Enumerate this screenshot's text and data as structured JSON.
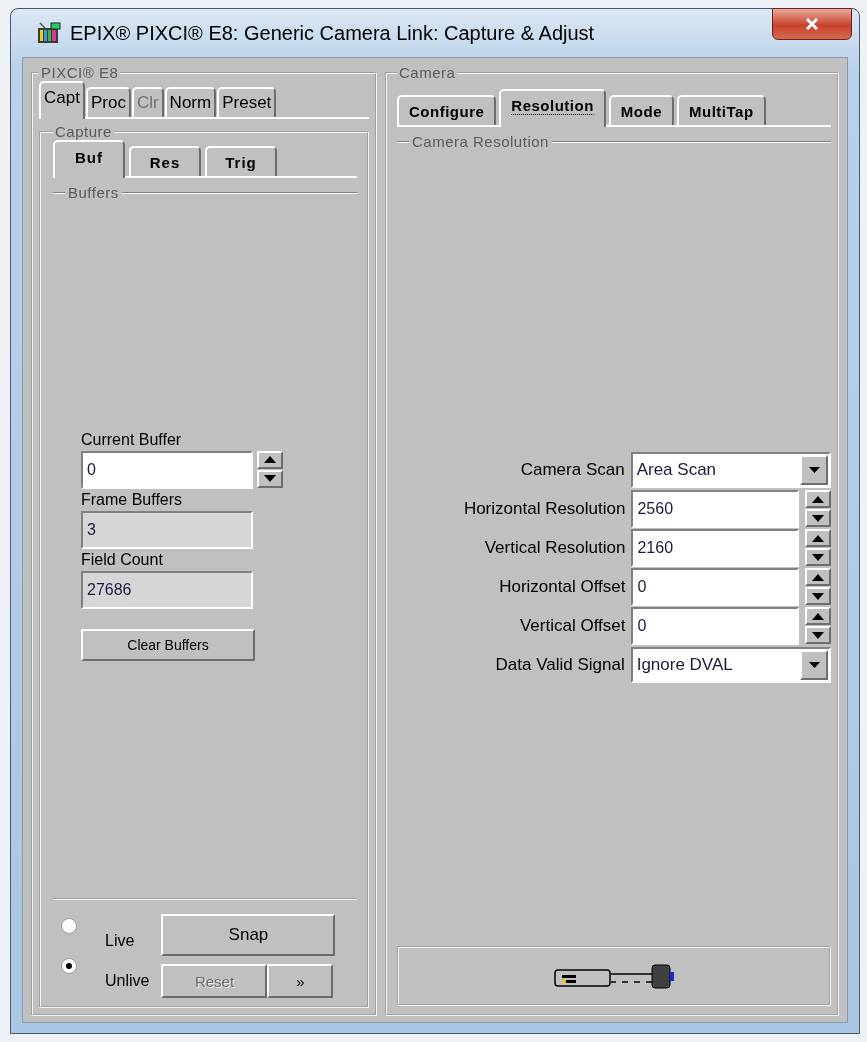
{
  "window": {
    "title": "EPIX® PIXCI® E8: Generic Camera Link: Capture & Adjust"
  },
  "left_panel": {
    "title": "PIXCI® E8",
    "tabs": [
      {
        "label": "Capt",
        "selected": true,
        "disabled": false
      },
      {
        "label": "Proc",
        "selected": false,
        "disabled": false
      },
      {
        "label": "Clr",
        "selected": false,
        "disabled": true
      },
      {
        "label": "Norm",
        "selected": false,
        "disabled": false
      },
      {
        "label": "Preset",
        "selected": false,
        "disabled": false
      }
    ],
    "capture": {
      "title": "Capture",
      "tabs": [
        {
          "label": "Buf",
          "selected": true
        },
        {
          "label": "Res",
          "selected": false
        },
        {
          "label": "Trig",
          "selected": false
        }
      ],
      "section_title": "Buffers",
      "fields": [
        {
          "label": "Current Buffer",
          "value": "0",
          "kind": "spin"
        },
        {
          "label": "Frame Buffers",
          "value": "3",
          "kind": "readonly"
        },
        {
          "label": "Field Count",
          "value": "27686",
          "kind": "readonly"
        }
      ],
      "clear_button": "Clear Buffers",
      "modes": [
        {
          "label": "Live",
          "selected": false
        },
        {
          "label": "Unlive",
          "selected": true
        }
      ],
      "buttons": [
        {
          "label": "Snap",
          "disabled": false
        },
        {
          "label": "Reset",
          "disabled": true
        },
        {
          "label": "»",
          "disabled": false
        }
      ]
    }
  },
  "right_panel": {
    "title": "Camera",
    "tabs": [
      {
        "label": "Configure",
        "selected": false
      },
      {
        "label": "Resolution",
        "selected": true
      },
      {
        "label": "Mode",
        "selected": false
      },
      {
        "label": "MultiTap",
        "selected": false
      }
    ],
    "section_title": "Camera Resolution",
    "fields": [
      {
        "label": "Camera Scan",
        "value": "Area Scan",
        "kind": "dropdown"
      },
      {
        "label": "Horizontal Resolution",
        "value": "2560",
        "kind": "spin"
      },
      {
        "label": "Vertical Resolution",
        "value": "2160",
        "kind": "spin"
      },
      {
        "label": "Horizontal Offset",
        "value": "0",
        "kind": "spin"
      },
      {
        "label": "Vertical Offset",
        "value": "0",
        "kind": "spin"
      },
      {
        "label": "Data Valid Signal",
        "value": "Ignore DVAL",
        "kind": "dropdown"
      }
    ]
  }
}
